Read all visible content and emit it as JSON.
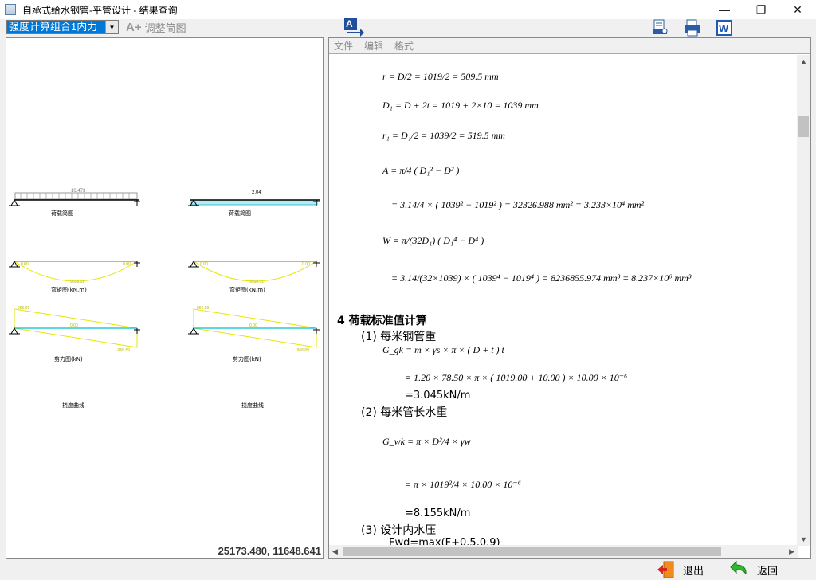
{
  "window": {
    "title": "自承式给水钢管-平管设计 - 结果查询"
  },
  "toolbar": {
    "combo_value": "强度计算组合1内力",
    "adjust_label": "调整简图"
  },
  "doc_menu": {
    "file": "文件",
    "edit": "编辑",
    "format": "格式"
  },
  "diagram": {
    "coords": "25173.480, 11648.641",
    "load_left_value": "10.473",
    "load_right_value": "2.04",
    "cap_left_1": "荷载简图",
    "cap_right_1": "荷载简图",
    "m_end_left": "0.00",
    "m_end_right": "0.00",
    "m_mid": "9558.01",
    "cap_left_2": "弯矩图(kN.m)",
    "cap_right_2": "弯矩图(kN.m)",
    "v_max": "966.69",
    "v_min": "-966.69",
    "v_mid": "0.00",
    "cap_left_3": "剪力图(kN)",
    "cap_right_3": "剪力图(kN)",
    "cap_left_4": "挠度曲线",
    "cap_right_4": "挠度曲线"
  },
  "doc": {
    "f1": "r = D/2 = 1019/2 = 509.5 mm",
    "f2": "D₁ = D + 2t = 1019 + 2×10 = 1039 mm",
    "f3": "r₁ = D₁/2 = 1039/2 = 519.5 mm",
    "f4": "A = π/4 ( D₁² − D² )",
    "f5": "= 3.14/4 × ( 1039² − 1019² ) = 32326.988 mm² = 3.233×10⁴ mm²",
    "f6": "W = π/(32D₁) ( D₁⁴ − D⁴ )",
    "f7": "= 3.14/(32×1039) × ( 1039⁴ − 1019⁴ ) = 8236855.974 mm³ = 8.237×10⁶ mm³",
    "h4": "4  荷载标准值计算",
    "s1": "(1) 每米钢管重",
    "g1": "G_gk = m × γs × π × ( D + t ) t",
    "g2": "= 1.20 × 78.50 × π × ( 1019.00 + 10.00 ) × 10.00 × 10⁻⁶",
    "g3": "=3.045kN/m",
    "s2": "(2) 每米管长水重",
    "w1": "G_wk = π × D²/4 × γw",
    "w2": "= π × 1019²/4 × 10.00 × 10⁻⁶",
    "w3": "=8.155kN/m",
    "s3": "(3) 设计内水压",
    "p1": "Fwd=max(F+0.5,0.9)"
  },
  "bottom": {
    "exit_label": "退出",
    "back_label": "返回"
  },
  "colors": {
    "accent": "#0078d7",
    "diagram_line": "#00bcd4",
    "diagram_fill": "#ffff00"
  }
}
